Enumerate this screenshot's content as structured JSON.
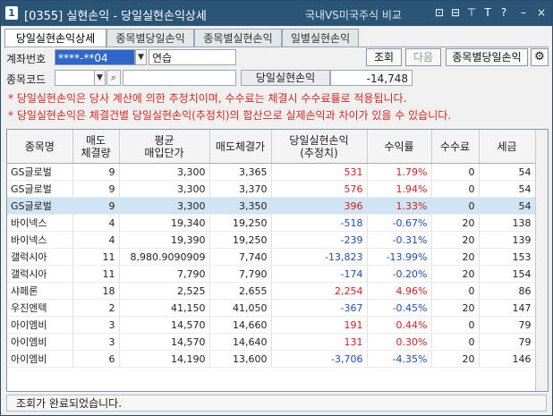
{
  "window": {
    "number": "1",
    "title": "[0355] 실현손익 - 당일실현손익상세",
    "compare_label": "국내VS미국주식 비교",
    "controls": [
      "⊡",
      "⊟",
      "⊤",
      "T",
      "?",
      "–",
      "×"
    ]
  },
  "tabs": [
    "당일실현손익상세",
    "종목별당일손익",
    "종목별실현손익",
    "일별실현손익"
  ],
  "form": {
    "account_label": "계좌번호",
    "account_value": "****-**04",
    "account_name": "연습",
    "stock_label": "종목코드",
    "stock_value": "",
    "pnl_label": "당일실현손익",
    "pnl_value": "-14,748"
  },
  "buttons": {
    "query": "조회",
    "next": "다음",
    "by_stock": "종목별당일손익"
  },
  "notes": [
    "* 당일실현손익은 당사 계산에 의한 추정치이며, 수수료는 체결시 수수료률로 적용됩니다.",
    "* 당일실현손익은 체결건별 당일실현손익(추정치)의 합산으로 실제손익과 차이가 있을 수 있습니다."
  ],
  "table": {
    "headers": [
      "종목명",
      "매도\n체결량",
      "평균\n매입단가",
      "매도체결가",
      "당일실현손익\n(추정치)",
      "수익률",
      "수수료",
      "세금"
    ],
    "rows": [
      {
        "name": "GS글로벌",
        "qty": "9",
        "avg": "3,300",
        "sell": "3,365",
        "pnl": "531",
        "rate": "1.79%",
        "fee": "0",
        "tax": "54",
        "sign": "up"
      },
      {
        "name": "GS글로벌",
        "qty": "9",
        "avg": "3,300",
        "sell": "3,370",
        "pnl": "576",
        "rate": "1.94%",
        "fee": "0",
        "tax": "54",
        "sign": "up"
      },
      {
        "name": "GS글로벌",
        "qty": "9",
        "avg": "3,300",
        "sell": "3,350",
        "pnl": "396",
        "rate": "1.33%",
        "fee": "0",
        "tax": "54",
        "sign": "up",
        "selected": true
      },
      {
        "name": "바이넥스",
        "qty": "4",
        "avg": "19,340",
        "sell": "19,250",
        "pnl": "-518",
        "rate": "-0.67%",
        "fee": "20",
        "tax": "138",
        "sign": "down"
      },
      {
        "name": "바이넥스",
        "qty": "4",
        "avg": "19,390",
        "sell": "19,250",
        "pnl": "-239",
        "rate": "-0.31%",
        "fee": "20",
        "tax": "139",
        "sign": "down"
      },
      {
        "name": "갤럭시아",
        "qty": "11",
        "avg": "8,980.9090909",
        "sell": "7,740",
        "pnl": "-13,823",
        "rate": "-13.99%",
        "fee": "20",
        "tax": "153",
        "sign": "down"
      },
      {
        "name": "갤럭시아",
        "qty": "11",
        "avg": "7,790",
        "sell": "7,790",
        "pnl": "-174",
        "rate": "-0.20%",
        "fee": "20",
        "tax": "154",
        "sign": "down"
      },
      {
        "name": "샤페론",
        "qty": "18",
        "avg": "2,525",
        "sell": "2,655",
        "pnl": "2,254",
        "rate": "4.96%",
        "fee": "0",
        "tax": "86",
        "sign": "up"
      },
      {
        "name": "우진엔텍",
        "qty": "2",
        "avg": "41,150",
        "sell": "41,050",
        "pnl": "-367",
        "rate": "-0.45%",
        "fee": "20",
        "tax": "147",
        "sign": "down"
      },
      {
        "name": "아이엠비",
        "qty": "3",
        "avg": "14,570",
        "sell": "14,660",
        "pnl": "191",
        "rate": "0.44%",
        "fee": "0",
        "tax": "79",
        "sign": "up"
      },
      {
        "name": "아이엠비",
        "qty": "3",
        "avg": "14,570",
        "sell": "14,640",
        "pnl": "131",
        "rate": "0.30%",
        "fee": "0",
        "tax": "79",
        "sign": "up"
      },
      {
        "name": "아이엠비",
        "qty": "6",
        "avg": "14,190",
        "sell": "13,600",
        "pnl": "-3,706",
        "rate": "-4.35%",
        "fee": "20",
        "tax": "146",
        "sign": "down"
      }
    ]
  },
  "status": "조회가 완료되었습니다.",
  "colors": {
    "title_bar": "#2b5577",
    "up": "#d42020",
    "down": "#1d4fb8",
    "note": "#d9281d",
    "selected_row": "#cfe4f4"
  }
}
